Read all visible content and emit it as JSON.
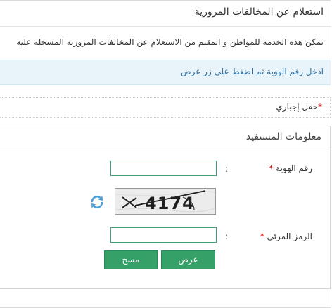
{
  "page": {
    "title": "استعلام عن المخالفات المرورية",
    "intro": "تمكن هذه الخدمة للمواطن و المقيم من الاستعلام عن المخالفات المرورية المسجلة عليه",
    "info": "ادخل رقم الهوية ثم اضغط على زر عرض",
    "required_note": {
      "star": "*",
      "text": "حقل إجباري"
    }
  },
  "form": {
    "panel_title": "معلومات المستفيد",
    "id_number": {
      "label": "رقم الهوية",
      "star": "*",
      "colon": ":",
      "value": "",
      "placeholder": ""
    },
    "captcha": {
      "image_text": "4174",
      "refresh_icon": "refresh-icon"
    },
    "visual_code": {
      "label": "الرمز المرئي",
      "star": "*",
      "colon": ":",
      "value": "",
      "placeholder": ""
    },
    "buttons": {
      "show": "عرض",
      "clear": "مسح"
    }
  },
  "colors": {
    "accent_green": "#35a068",
    "input_border": "#3ea374",
    "info_background": "#e9f3fa",
    "info_text": "#2f6f9f",
    "required_star": "#cc0000",
    "refresh_icon": "#4a9fd8"
  }
}
